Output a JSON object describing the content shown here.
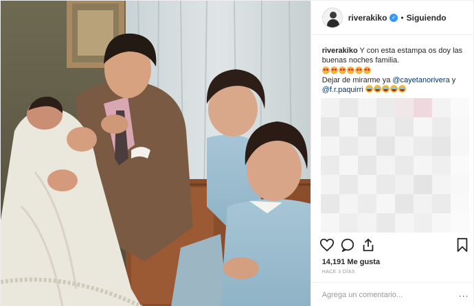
{
  "header": {
    "username": "riverakiko",
    "separator": "•",
    "follow_status": "Siguiendo",
    "verified_badge": "✓"
  },
  "caption": {
    "username": "riverakiko",
    "text": "Y con esta estampa os doy las buenas noches familia.",
    "emoji_row": [
      "heart-eyes-face",
      "heart-eyes-face",
      "heart-eyes-face",
      "heart-eyes-face",
      "heart-eyes-face",
      "heart-eyes-face"
    ],
    "line2_prefix": "Dejar de mirarme ya",
    "mention_1": "@cayetanorivera",
    "conj": "y",
    "mention_2": "@f.r.paquirri",
    "laugh_emojis": [
      "tears-of-joy-face",
      "tears-of-joy-face",
      "tears-of-joy-face",
      "tears-of-joy-face",
      "tears-of-joy-face"
    ]
  },
  "actions": {
    "like_icon": "heart-outline-icon",
    "comment_icon": "comment-bubble-icon",
    "share_icon": "share-icon",
    "save_icon": "bookmark-icon"
  },
  "likes": {
    "count": "14,191",
    "label": "Me gusta"
  },
  "time_ago": "HACE 3 DÍAS",
  "comment": {
    "placeholder": "Agrega un comentario...",
    "more_glyph": "···"
  },
  "colors": {
    "accent": "#3897f0",
    "mention": "#003569",
    "muted": "#999999"
  }
}
